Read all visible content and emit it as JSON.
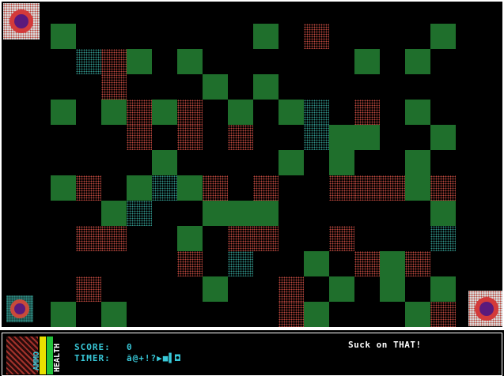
{
  "hud": {
    "score_label": "SCORE:",
    "score_value": "0",
    "timer_label": "TIMER:",
    "timer_value": "ã@+!?▶■▌◘",
    "ammo_label": "AMMO",
    "health_label": "HEALTH",
    "message": "Suck on THAT!"
  },
  "colors": {
    "wall": "#1f6f2c",
    "brick": "#b8463d",
    "teal_brick": "#2f8f86",
    "hud_text": "#38c8d8",
    "ammo_bar": "#e8e000",
    "health_bar": "#22c23a"
  },
  "players": [
    {
      "name": "player-top-left",
      "base": "brick",
      "ring": "#d33a3a",
      "core": "#5a1a7c"
    },
    {
      "name": "player-bottom-left",
      "base": "teal",
      "ring": "#c94a3a",
      "core": "#5a1a7c"
    },
    {
      "name": "player-bottom-right",
      "base": "brick",
      "ring": "#d33a3a",
      "core": "#5a1a7c"
    }
  ]
}
